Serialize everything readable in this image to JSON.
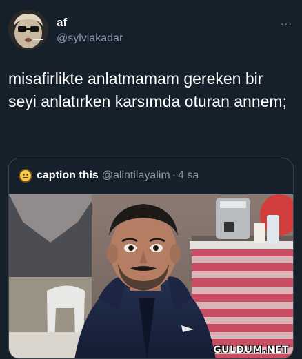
{
  "tweet": {
    "author_name": "af",
    "author_handle": "@sylviakadar",
    "more_glyph": "···",
    "text": "misafirlikte anlatmamam gereken bir seyi anlatırken karsımda oturan annem;"
  },
  "quoted_tweet": {
    "author_name": "caption this",
    "author_handle": "@alintilayalim",
    "separator": "·",
    "time": "4 sa"
  },
  "watermark": "GULDUM.NET",
  "colors": {
    "background": "#15202b",
    "text_primary": "#ffffff",
    "text_secondary": "#8899a6",
    "border": "#38444d"
  }
}
